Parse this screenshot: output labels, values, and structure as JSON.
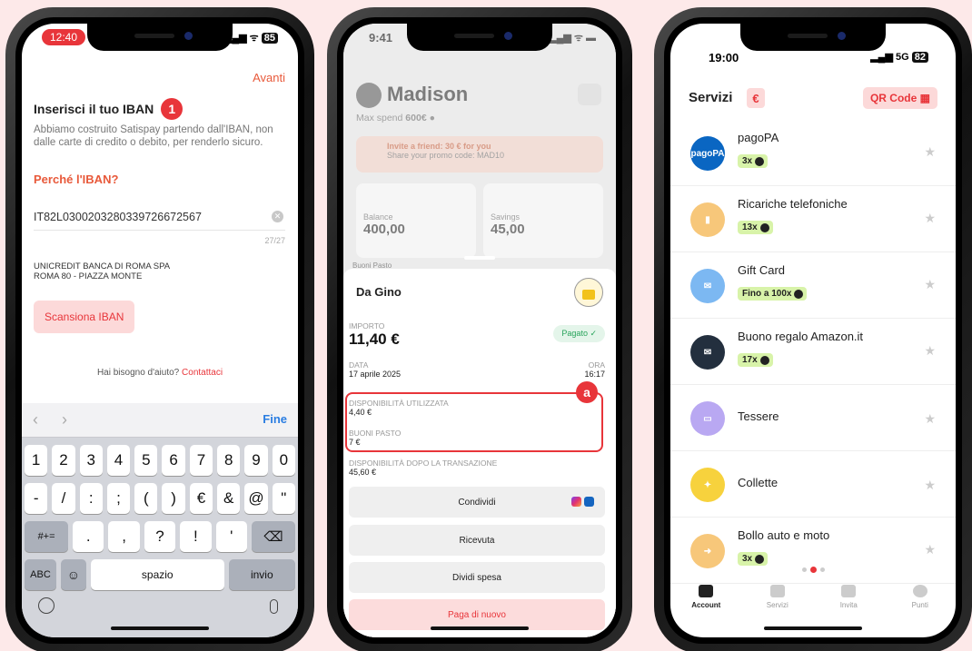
{
  "phone1": {
    "time": "12:40",
    "battery": "85",
    "next_label": "Avanti",
    "step_number": "1",
    "title": "Inserisci il tuo IBAN",
    "description": "Abbiamo costruito Satispay partendo dall'IBAN, non dalle carte di credito o debito, per renderlo sicuro.",
    "why_link": "Perché l'IBAN?",
    "iban_value": "IT82L0300203280339726672567",
    "char_counter": "27/27",
    "bank_line1": "UNICREDIT BANCA DI ROMA SPA",
    "bank_line2": "ROMA 80 - PIAZZA MONTE",
    "scan_button": "Scansiona IBAN",
    "help_text": "Hai bisogno d'aiuto?",
    "help_link": "Contattaci",
    "keyboard": {
      "done_label": "Fine",
      "row1": [
        "1",
        "2",
        "3",
        "4",
        "5",
        "6",
        "7",
        "8",
        "9",
        "0"
      ],
      "row2": [
        "-",
        "/",
        ":",
        ";",
        "(",
        ")",
        "€",
        "&",
        "@",
        "\""
      ],
      "row3_mode": "#+=",
      "row3": [
        ".",
        ",",
        "?",
        "!",
        "'"
      ],
      "abc": "ABC",
      "space": "spazio",
      "enter": "invio"
    }
  },
  "phone2": {
    "time": "9:41",
    "user_name": "Madison",
    "max_spend_label": "Max spend",
    "max_spend_value": "600€",
    "invite_title": "Invite a friend: 30 € for you",
    "invite_sub": "Share your promo code: MAD10",
    "balance_label": "Balance",
    "balance_value": "400,00",
    "savings_label": "Savings",
    "savings_value": "45,00",
    "buoni_header": "Buoni Pasto",
    "merchant": "Da Gino",
    "importo_label": "IMPORTO",
    "amount": "11,40 €",
    "status": "Pagato ✓",
    "data_label": "DATA",
    "date": "17 aprile 2025",
    "ora_label": "ORA",
    "time_value": "16:17",
    "marker": "a",
    "disp_label": "DISPONIBILITÀ UTILIZZATA",
    "disp_value": "4,40 €",
    "buoni_label": "BUONI PASTO",
    "buoni_value": "7 €",
    "after_label": "DISPONIBILITÀ DOPO LA TRANSAZIONE",
    "after_value": "45,60 €",
    "share_button": "Condividi",
    "receipt_button": "Ricevuta",
    "split_button": "Dividi spesa",
    "pay_again_button": "Paga di nuovo"
  },
  "phone3": {
    "time": "19:00",
    "network": "5G",
    "battery": "82",
    "title": "Servizi",
    "euro_symbol": "€",
    "qr_button": "QR Code",
    "services": [
      {
        "name": "pagoPA",
        "chip": "3x",
        "icon": "pagopa-icon",
        "color": "#0a66c2",
        "glyph": "pagoPA"
      },
      {
        "name": "Ricariche telefoniche",
        "chip": "13x",
        "icon": "phone-topup-icon",
        "color": "#f7c77a",
        "glyph": "▮"
      },
      {
        "name": "Gift Card",
        "chip": "Fino a 100x",
        "icon": "gift-card-icon",
        "color": "#7cb8f2",
        "glyph": "✉"
      },
      {
        "name": "Buono regalo Amazon.it",
        "chip": "17x",
        "icon": "amazon-icon",
        "color": "#232f3e",
        "glyph": "✉"
      },
      {
        "name": "Tessere",
        "chip": "",
        "icon": "loyalty-card-icon",
        "color": "#b9a8f2",
        "glyph": "▭"
      },
      {
        "name": "Collette",
        "chip": "",
        "icon": "group-icon",
        "color": "#f7d23d",
        "glyph": "✦"
      },
      {
        "name": "Bollo auto e moto",
        "chip": "3x",
        "icon": "car-tax-icon",
        "color": "#f7c77a",
        "glyph": "➜"
      }
    ],
    "tabs": [
      "Account",
      "Servizi",
      "Invita",
      "Punti"
    ]
  }
}
